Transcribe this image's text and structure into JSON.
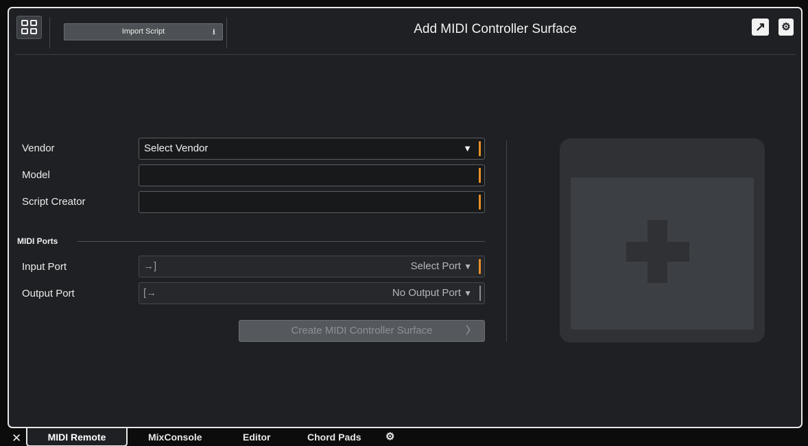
{
  "header": {
    "import_label": "Import Script",
    "title": "Add MIDI Controller Surface"
  },
  "form": {
    "vendor_label": "Vendor",
    "vendor_value": "Select Vendor",
    "model_label": "Model",
    "model_value": "",
    "creator_label": "Script Creator",
    "creator_value": ""
  },
  "midi_ports": {
    "section_label": "MIDI Ports",
    "input_label": "Input Port",
    "input_value": "Select Port",
    "output_label": "Output Port",
    "output_value": "No Output Port"
  },
  "create_label": "Create MIDI Controller Surface",
  "tabs": [
    {
      "label": "MIDI Remote"
    },
    {
      "label": "MixConsole"
    },
    {
      "label": "Editor"
    },
    {
      "label": "Chord Pads"
    }
  ],
  "icons": {
    "open_external": "↗",
    "settings": "⚙",
    "close": "✕",
    "dropdown": "▼",
    "chevron": "〉"
  }
}
